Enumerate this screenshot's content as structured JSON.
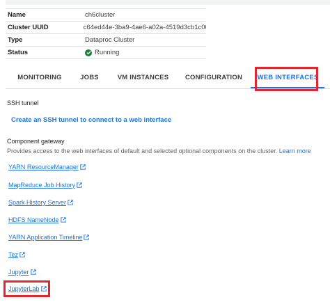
{
  "details": {
    "rows": [
      {
        "key": "Name",
        "value": "ch6cluster"
      },
      {
        "key": "Cluster UUID",
        "value": "c64ed44e-3ba9-4ae6-a02a-4519d3cb1c00"
      },
      {
        "key": "Type",
        "value": "Dataproc Cluster"
      },
      {
        "key": "Status",
        "value": "Running"
      }
    ]
  },
  "tabs": [
    {
      "label": "MONITORING"
    },
    {
      "label": "JOBS"
    },
    {
      "label": "VM INSTANCES"
    },
    {
      "label": "CONFIGURATION"
    },
    {
      "label": "WEB INTERFACES"
    }
  ],
  "ssh": {
    "title": "SSH tunnel",
    "link": "Create an SSH tunnel to connect to a web interface"
  },
  "gateway": {
    "title": "Component gateway",
    "description": "Provides access to the web interfaces of default and selected optional components on the cluster.",
    "learn_more": "Learn more",
    "links": [
      {
        "label": "YARN ResourceManager"
      },
      {
        "label": "MapReduce Job History"
      },
      {
        "label": "Spark History Server"
      },
      {
        "label": "HDFS NameNode"
      },
      {
        "label": "YARN Application Timeline"
      },
      {
        "label": "Tez"
      },
      {
        "label": "Jupyter"
      },
      {
        "label": "JupyterLab"
      }
    ]
  },
  "colors": {
    "accent": "#1a73e8",
    "status_ok": "#188038",
    "highlight": "#e4262c"
  },
  "icons": {
    "status": "check-circle-icon",
    "link": "external-link-icon"
  }
}
